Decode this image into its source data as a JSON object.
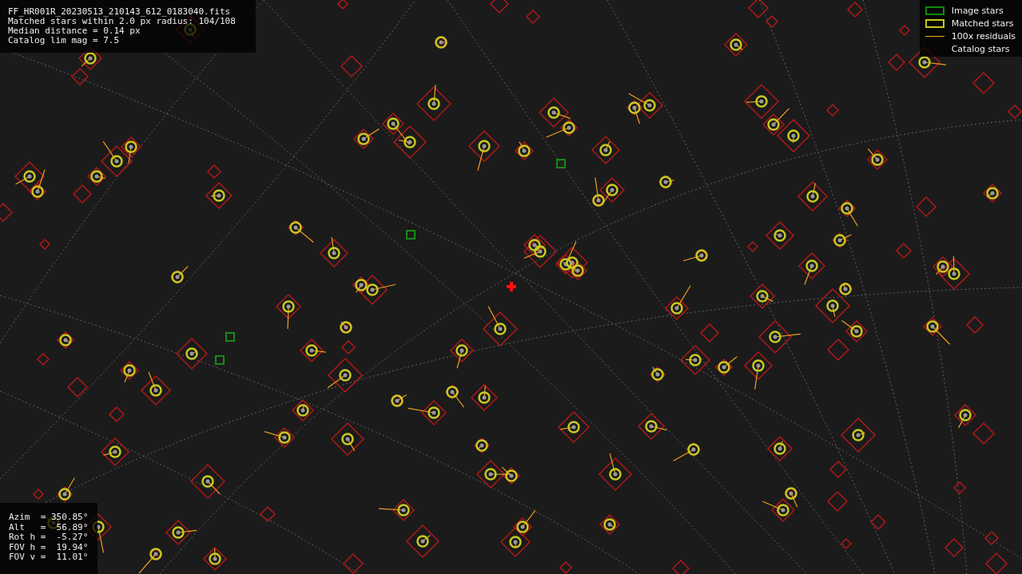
{
  "info_lines": [
    "FF_HR001R_20230513_210143_612_0183040.fits",
    "Matched stars within 2.0 px radius: 104/108",
    "Median distance = 0.14 px",
    "Catalog lim mag = 7.5"
  ],
  "legend": [
    {
      "kind": "image",
      "label": "Image stars"
    },
    {
      "kind": "matched",
      "label": "Matched stars"
    },
    {
      "kind": "residual",
      "label": "100x residuals"
    },
    {
      "kind": "catalog",
      "label": "Catalog stars"
    }
  ],
  "pointing_lines": [
    "Azim  = 350.85°",
    "Alt   =  56.89°",
    "Rot h =  -5.27°",
    "FOV h =  19.94°",
    "FOV v =  11.01°"
  ]
}
